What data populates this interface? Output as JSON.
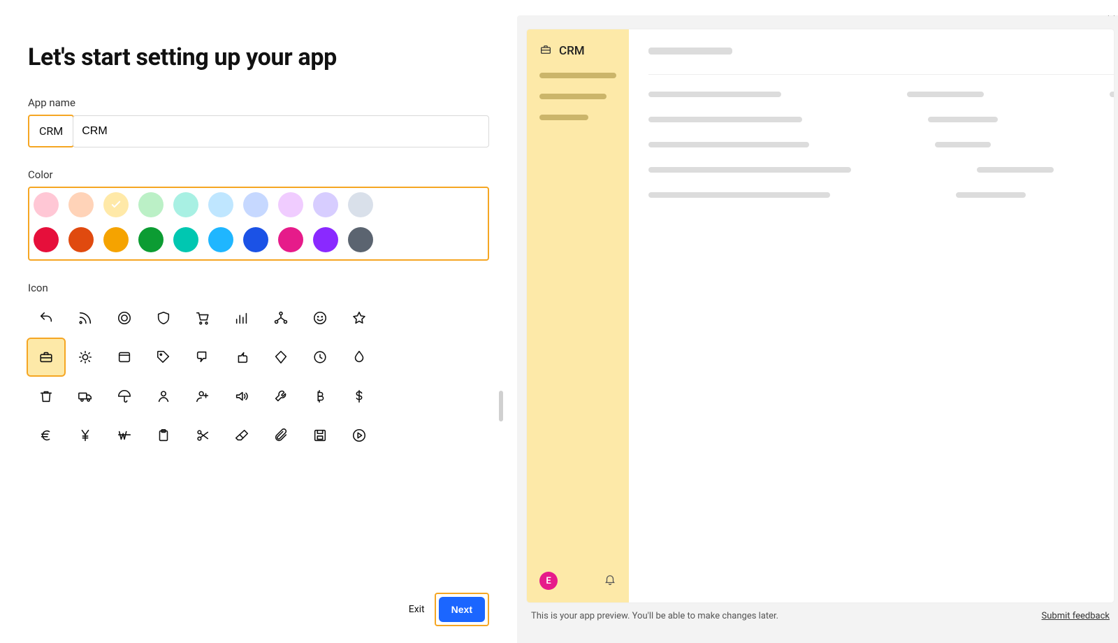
{
  "heading": "Let's start setting up your app",
  "labels": {
    "appName": "App name",
    "color": "Color",
    "icon": "Icon"
  },
  "app": {
    "name": "CRM"
  },
  "colors": {
    "light": [
      "#ffc7d5",
      "#ffd3b8",
      "#ffe9a8",
      "#bbf0c6",
      "#a8f0e3",
      "#bfe6ff",
      "#c6d8ff",
      "#f0ccff",
      "#d7cdff",
      "#d9e0ea"
    ],
    "bold": [
      "#e60f3b",
      "#e04a0f",
      "#f5a300",
      "#0c9c33",
      "#00c7b1",
      "#1fb6ff",
      "#1b52e6",
      "#e61b8a",
      "#8a29ff",
      "#5b6470"
    ],
    "selectedIndex": 2
  },
  "icons": [
    [
      "reply",
      "rss",
      "target",
      "shield",
      "cart",
      "bars",
      "org",
      "smile",
      "star"
    ],
    [
      "briefcase",
      "sun",
      "window",
      "tag",
      "thumbs-down",
      "thumbs-up",
      "diamond",
      "clock",
      "droplet"
    ],
    [
      "trash",
      "truck",
      "umbrella",
      "user",
      "user-add",
      "volume",
      "wrench",
      "bitcoin",
      "dollar"
    ],
    [
      "euro",
      "yen",
      "won",
      "clipboard",
      "scissors",
      "eraser",
      "paperclip",
      "save",
      "play-circle"
    ]
  ],
  "selectedIcon": "briefcase",
  "buttons": {
    "exit": "Exit",
    "next": "Next"
  },
  "preview": {
    "appName": "CRM",
    "avatarLetter": "E",
    "caption": "This is your app preview. You'll be able to make changes later.",
    "feedback": "Submit feedback"
  }
}
